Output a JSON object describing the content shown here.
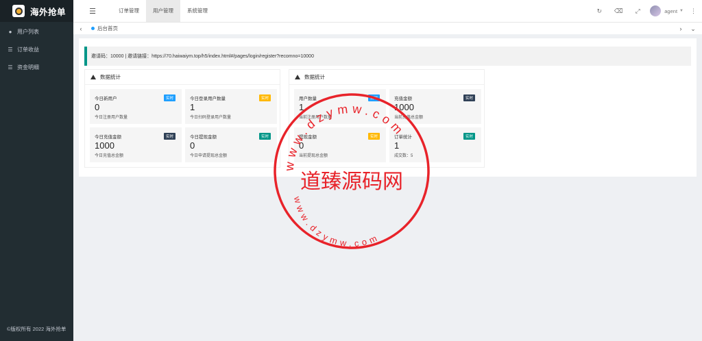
{
  "app": {
    "title": "海外抢单"
  },
  "sidebar": {
    "items": [
      {
        "label": "用户列表",
        "icon": "users-icon"
      },
      {
        "label": "订单收益",
        "icon": "list-icon"
      },
      {
        "label": "资金明细",
        "icon": "list-icon"
      }
    ],
    "footer": "©版权所有 2022 海外抢单"
  },
  "topnav": {
    "tabs": [
      {
        "label": "订单管理",
        "active": false
      },
      {
        "label": "用户管理",
        "active": true
      },
      {
        "label": "系统管理",
        "active": false
      }
    ],
    "user": "agent"
  },
  "breadcrumb": {
    "tab": "后台首页"
  },
  "invite": {
    "text": "邀请码：10000 | 邀请链接：https://70.haiwaiym.top/h5/index.html#/pages/login/register?recomno=10000"
  },
  "panels": [
    {
      "title": "数据统计",
      "stats": [
        {
          "title": "今日新用户",
          "value": "0",
          "desc": "今日注册用户数量",
          "badge": "实时",
          "badge_color": "#1e9fff"
        },
        {
          "title": "今日登录用户数量",
          "value": "1",
          "desc": "今日扫码登录用户数量",
          "badge": "实时",
          "badge_color": "#ffb800"
        },
        {
          "title": "今日充值金额",
          "value": "1000",
          "desc": "今日充值总金额",
          "badge": "实时",
          "badge_color": "#2f4056"
        },
        {
          "title": "今日提现金额",
          "value": "0",
          "desc": "今日申请提现总金额",
          "badge": "实时",
          "badge_color": "#009688"
        }
      ]
    },
    {
      "title": "数据统计",
      "stats": [
        {
          "title": "用户数量",
          "value": "1",
          "desc": "当前注册用户数量",
          "badge": "实时",
          "badge_color": "#1e9fff"
        },
        {
          "title": "充值金额",
          "value": "1000",
          "desc": "当前充值总金额",
          "badge": "实时",
          "badge_color": "#2f4056"
        },
        {
          "title": "提现金额",
          "value": "0",
          "desc": "当前提现总金额",
          "badge": "实时",
          "badge_color": "#ffb800"
        },
        {
          "title": "订单统计",
          "value": "1",
          "desc": "成交数：5",
          "badge": "实时",
          "badge_color": "#009688"
        }
      ]
    }
  ],
  "watermark": {
    "main": "道臻源码网",
    "url_top": "www.dzymw.com",
    "url_bottom": "www.dzymw.com"
  }
}
